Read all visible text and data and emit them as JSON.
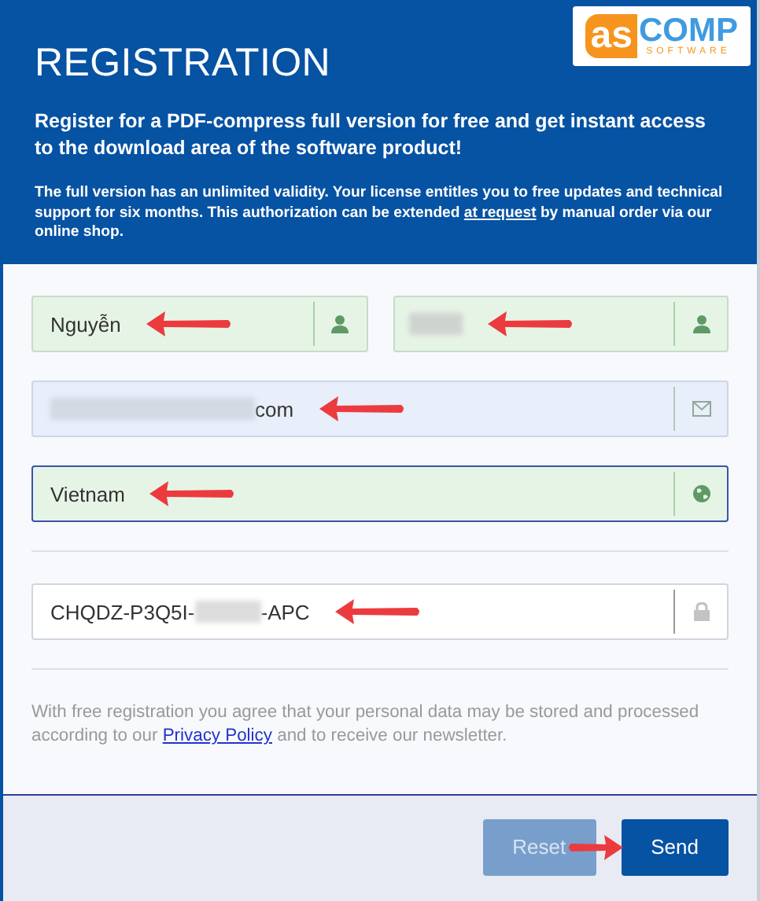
{
  "header": {
    "title": "REGISTRATION",
    "logo": {
      "mark": "as",
      "name": "COMP",
      "tagline": "SOFTWARE"
    },
    "intro": "Register for a PDF-compress full version for free and get instant access to the download area of the software product!",
    "note": {
      "before": "The full version has an unlimited validity. Your license entitles you to free updates and technical support for six months. This authorization can be extended",
      "link": "at request",
      "after": "by manual order via our online shop."
    }
  },
  "fields": [
    {
      "kind": "name",
      "value": "Nguyễn",
      "redacted": false,
      "valid": true,
      "autofilled": false,
      "focused": false,
      "annotated": true
    },
    {
      "kind": "name",
      "redacted": true,
      "valid": true,
      "autofilled": false,
      "focused": false,
      "annotated": true
    },
    {
      "kind": "email",
      "redacted": true,
      "value_after": "com",
      "valid": false,
      "autofilled": true,
      "focused": false,
      "annotated": true
    },
    {
      "kind": "country",
      "value": "Vietnam",
      "redacted": false,
      "valid": true,
      "autofilled": false,
      "focused": true,
      "annotated": true
    },
    {
      "kind": "license",
      "value": "CHQDZ-P3Q5I-",
      "redacted": true,
      "value_after": "-APC",
      "valid": false,
      "autofilled": false,
      "focused": false,
      "annotated": true
    }
  ],
  "consent": {
    "before": "With free registration you agree that your personal data may be stored and processed according to our",
    "link": "Privacy Policy",
    "after": "and to receive our newsletter."
  },
  "buttons": [
    {
      "label": "Reset",
      "disabled": true,
      "annotated": false
    },
    {
      "label": "Send",
      "disabled": false,
      "annotated": true
    }
  ]
}
